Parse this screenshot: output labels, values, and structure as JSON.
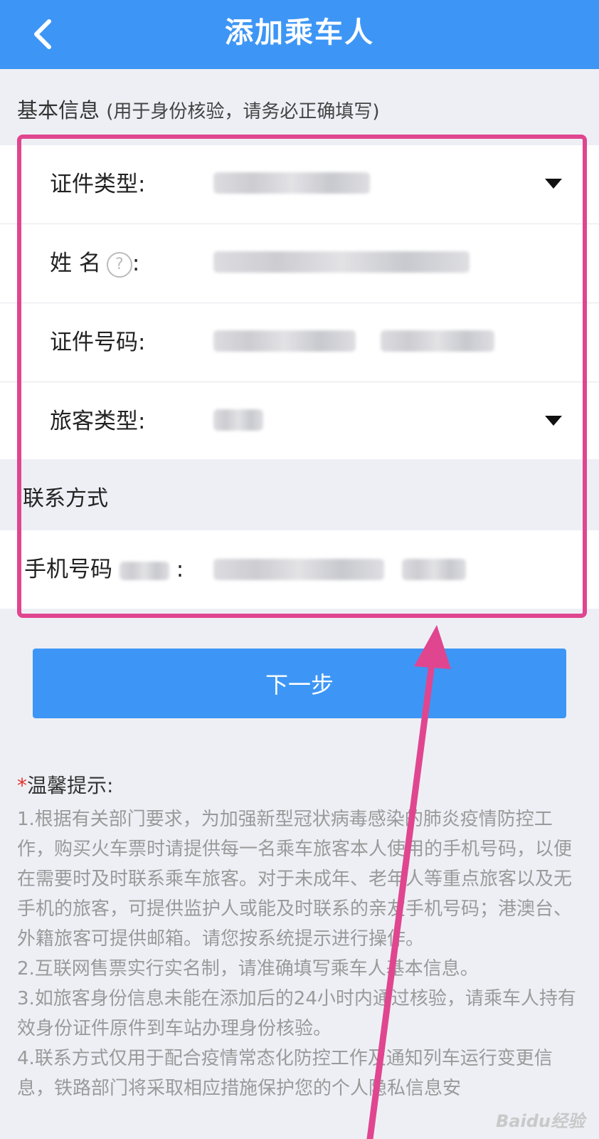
{
  "header": {
    "title": "添加乘车人",
    "back_icon": "chevron-left-icon"
  },
  "basic_info": {
    "title": "基本信息",
    "hint": "(用于身份核验，请务必正确填写)"
  },
  "fields": {
    "id_type": {
      "label": "证件类型:"
    },
    "name": {
      "label": "姓 名",
      "colon": ":",
      "help_icon": "question-circle-icon",
      "help_glyph": "?"
    },
    "id_number": {
      "label": "证件号码:"
    },
    "passenger_type": {
      "label": "旅客类型:"
    }
  },
  "contact": {
    "title": "联系方式",
    "phone_label": "手机号码",
    "phone_colon": ":"
  },
  "next_button": {
    "label": "下一步"
  },
  "tips": {
    "star": "*",
    "title": "温馨提示:",
    "items": [
      "1.根据有关部门要求，为加强新型冠状病毒感染的肺炎疫情防控工作，购买火车票时请提供每一名乘车旅客本人使用的手机号码，以便在需要时及时联系乘车旅客。对于未成年、老年人等重点旅客以及无手机的旅客，可提供监护人或能及时联系的亲友手机号码；港澳台、外籍旅客可提供邮箱。请您按系统提示进行操作。",
      "2.互联网售票实行实名制，请准确填写乘车人基本信息。",
      "3.如旅客身份信息未能在添加后的24小时内通过核验，请乘车人持有效身份证件原件到车站办理身份核验。",
      "4.联系方式仅用于配合疫情常态化防控工作及通知列车运行变更信息，铁路部门将采取相应措施保护您的个人隐私信息安"
    ]
  },
  "watermark": "Baidu经验",
  "colors": {
    "brand_blue": "#3d96f5",
    "highlight_pink": "#e0468f",
    "required_red": "#e0342c"
  }
}
